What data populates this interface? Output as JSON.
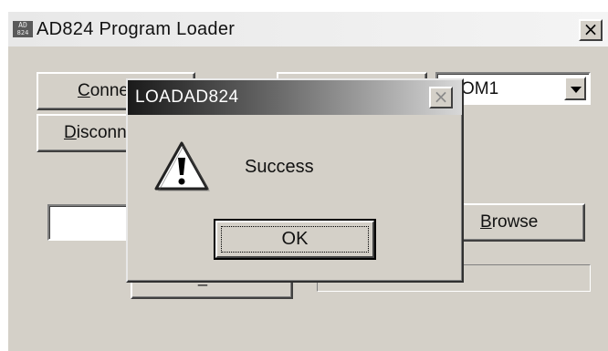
{
  "main_window": {
    "title": "AD824 Program Loader",
    "icon_text_top": "AD",
    "icon_text_bottom": "824",
    "close_glyph": "×",
    "connect_label_first": "C",
    "connect_label_rest": "onne",
    "disconnect_label_first": "D",
    "disconnect_label_rest": "isconn",
    "port_value": "OM1",
    "browse_label_first": "B",
    "browse_label_rest": "rowse",
    "hidden_button_char": "_"
  },
  "dialog": {
    "title": "LOADAD824",
    "close_glyph": "×",
    "icon": "warning-icon",
    "message": "Success",
    "ok_label": "OK"
  }
}
